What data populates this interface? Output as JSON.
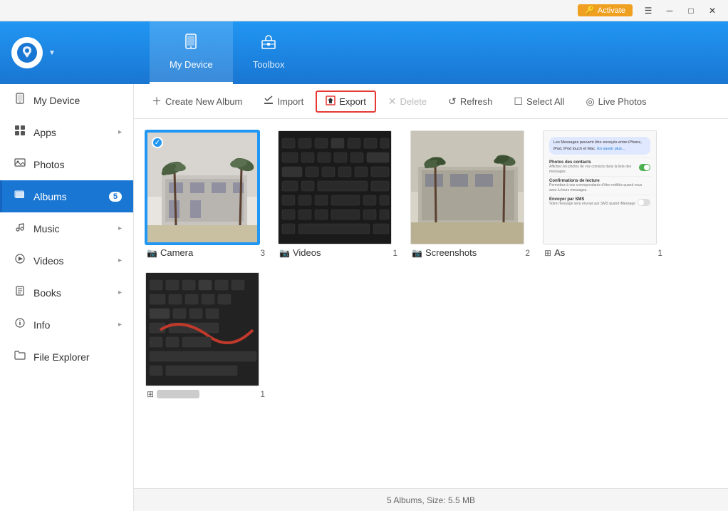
{
  "titleBar": {
    "activateLabel": "Activate",
    "minLabel": "─",
    "maxLabel": "□",
    "closeLabel": "✕",
    "hamburgerLabel": "☰"
  },
  "header": {
    "logoSymbol": "🎵",
    "tabs": [
      {
        "id": "my-device",
        "label": "My Device",
        "icon": "📱",
        "active": true
      },
      {
        "id": "toolbox",
        "label": "Toolbox",
        "icon": "🧰",
        "active": false
      }
    ]
  },
  "sidebar": {
    "items": [
      {
        "id": "my-device",
        "label": "My Device",
        "icon": "📱",
        "active": false,
        "hasArrow": false
      },
      {
        "id": "apps",
        "label": "Apps",
        "icon": "⊞",
        "active": false,
        "hasArrow": true
      },
      {
        "id": "photos",
        "label": "Photos",
        "icon": "🖼",
        "active": false,
        "hasArrow": false
      },
      {
        "id": "albums",
        "label": "Albums",
        "icon": "🗂",
        "active": true,
        "hasArrow": false,
        "badge": "5"
      },
      {
        "id": "music",
        "label": "Music",
        "icon": "♪",
        "active": false,
        "hasArrow": true
      },
      {
        "id": "videos",
        "label": "Videos",
        "icon": "▶",
        "active": false,
        "hasArrow": true
      },
      {
        "id": "books",
        "label": "Books",
        "icon": "📋",
        "active": false,
        "hasArrow": true
      },
      {
        "id": "info",
        "label": "Info",
        "icon": "ℹ",
        "active": false,
        "hasArrow": true
      },
      {
        "id": "file-explorer",
        "label": "File Explorer",
        "icon": "📁",
        "active": false,
        "hasArrow": false
      }
    ]
  },
  "toolbar": {
    "buttons": [
      {
        "id": "create-album",
        "label": "Create New Album",
        "icon": "+",
        "disabled": false
      },
      {
        "id": "import",
        "label": "Import",
        "icon": "✔",
        "disabled": false
      },
      {
        "id": "export",
        "label": "Export",
        "icon": "↗",
        "disabled": false,
        "highlighted": true
      },
      {
        "id": "delete",
        "label": "Delete",
        "icon": "✕",
        "disabled": true
      },
      {
        "id": "refresh",
        "label": "Refresh",
        "icon": "↺",
        "disabled": false
      },
      {
        "id": "select-all",
        "label": "Select All",
        "icon": "☐",
        "disabled": false
      },
      {
        "id": "live-photos",
        "label": "Live Photos",
        "icon": "◎",
        "disabled": false
      }
    ]
  },
  "albums": [
    {
      "id": "camera",
      "name": "Camera",
      "count": 3,
      "selected": true,
      "type": "camera",
      "icon": "📷"
    },
    {
      "id": "videos",
      "name": "Videos",
      "count": 1,
      "selected": false,
      "type": "keyboard",
      "icon": "📷"
    },
    {
      "id": "screenshots",
      "name": "Screenshots",
      "count": 2,
      "selected": false,
      "type": "beach",
      "icon": "📷"
    },
    {
      "id": "as",
      "name": "As",
      "count": 1,
      "selected": false,
      "type": "messages",
      "icon": "📷"
    },
    {
      "id": "blurred",
      "name": "",
      "count": 1,
      "selected": false,
      "type": "blurred",
      "icon": "📷"
    }
  ],
  "statusBar": {
    "text": "5 Albums, Size: 5.5 MB"
  },
  "messages": {
    "bubble": "Les Messages peuvent être envoyés entre iPhone, iPad, iPod touch et Mac.",
    "learnMore": "En savoir plus...",
    "contacts": "Photos des contacts",
    "contactsDesc": "Affichez les photos de vos contacts dans la liste des messages.",
    "readReceipts": "Confirmations de lecture",
    "readReceiptsDesc": "Permettez à vos correspondants d'être notifiés quand vous avez lu leurs messages.",
    "sendSms": "Envoyer par SMS",
    "sendSmsDesc": "Votre message sera envoyé par SMS quand iMessage"
  }
}
